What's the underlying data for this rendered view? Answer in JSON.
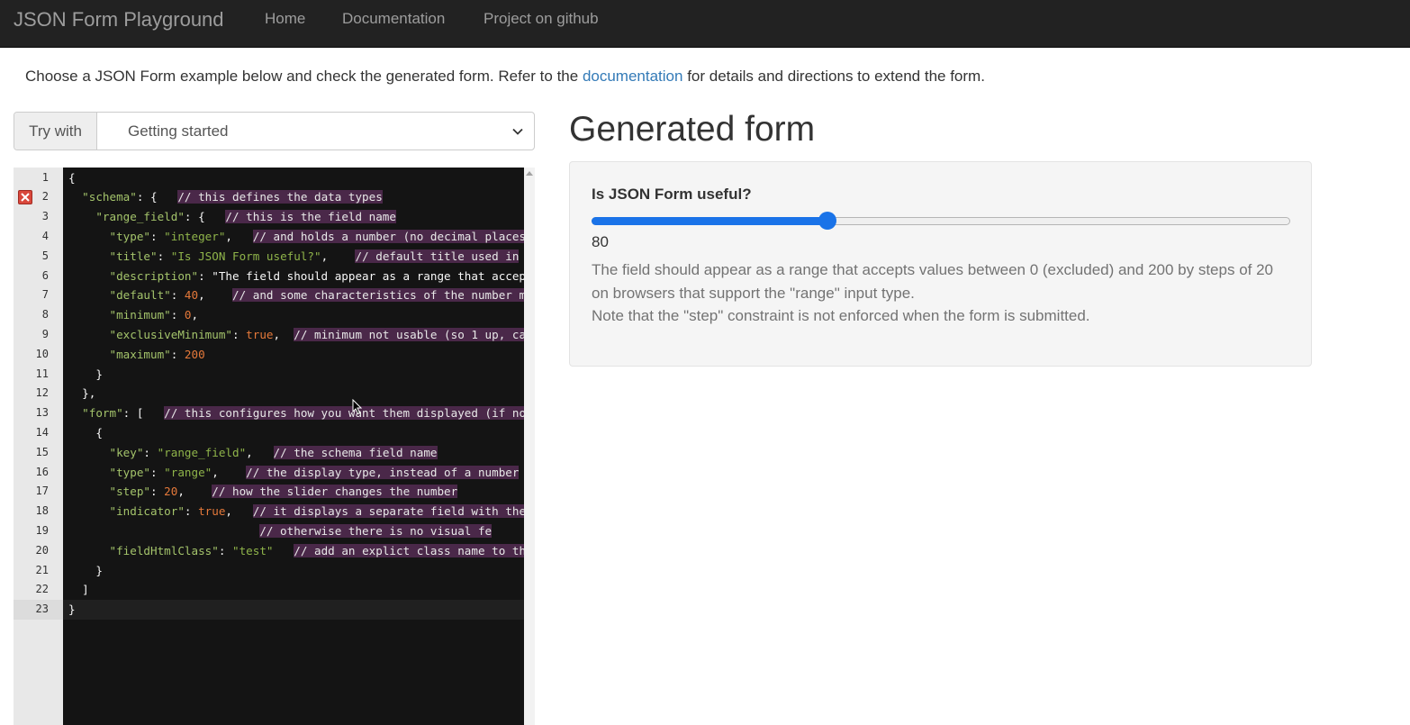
{
  "navbar": {
    "brand": "JSON Form Playground",
    "links": [
      "Home",
      "Documentation",
      "Project on github"
    ]
  },
  "intro": {
    "before": "Choose a JSON Form example below and check the generated form. Refer to the ",
    "link": "documentation",
    "after": " for details and directions to extend the form."
  },
  "try_with": {
    "label": "Try with",
    "selected": "Getting started"
  },
  "editor": {
    "error_line": 2,
    "active_line": 23,
    "lines": [
      "{",
      "  \"schema\": {   // this defines the data types",
      "    \"range_field\": {   // this is the field name",
      "      \"type\": \"integer\",   // and holds a number (no decimal places",
      "      \"title\": \"Is JSON Form useful?\",    // default title used in",
      "      \"description\": \"The field should appear as a range that accep",
      "      \"default\": 40,    // and some characteristics of the number m",
      "      \"minimum\": 0,",
      "      \"exclusiveMinimum\": true,  // minimum not usable (so 1 up, ca",
      "      \"maximum\": 200",
      "    }",
      "  },",
      "  \"form\": [   // this configures how you want them displayed (if no",
      "    {",
      "      \"key\": \"range_field\",   // the schema field name",
      "      \"type\": \"range\",    // the display type, instead of a number",
      "      \"step\": 20,    // how the slider changes the number",
      "      \"indicator\": true,   // it displays a separate field with the",
      "                            // otherwise there is no visual fe",
      "      \"fieldHtmlClass\": \"test\"   // add an explict class name to th",
      "    }",
      "  ]",
      "}"
    ]
  },
  "generated": {
    "title": "Generated form",
    "field_label": "Is JSON Form useful?",
    "range": {
      "min": 0,
      "max": 200,
      "value": 80,
      "value_text": "80"
    },
    "help_line1": "The field should appear as a range that accepts values between 0 (excluded) and 200 by steps of 20 on browsers that support the \"range\" input type.",
    "help_line2": "Note that the \"step\" constraint is not enforced when the form is submitted."
  },
  "colors": {
    "accent": "#1a73e8",
    "link": "#337ab7",
    "navbar": "#222222",
    "editor_bg": "#141414",
    "comment_bg": "#4a2849"
  },
  "icons": [
    "error-icon",
    "chevron-down-icon",
    "scroll-up-icon",
    "mouse-cursor-icon"
  ]
}
